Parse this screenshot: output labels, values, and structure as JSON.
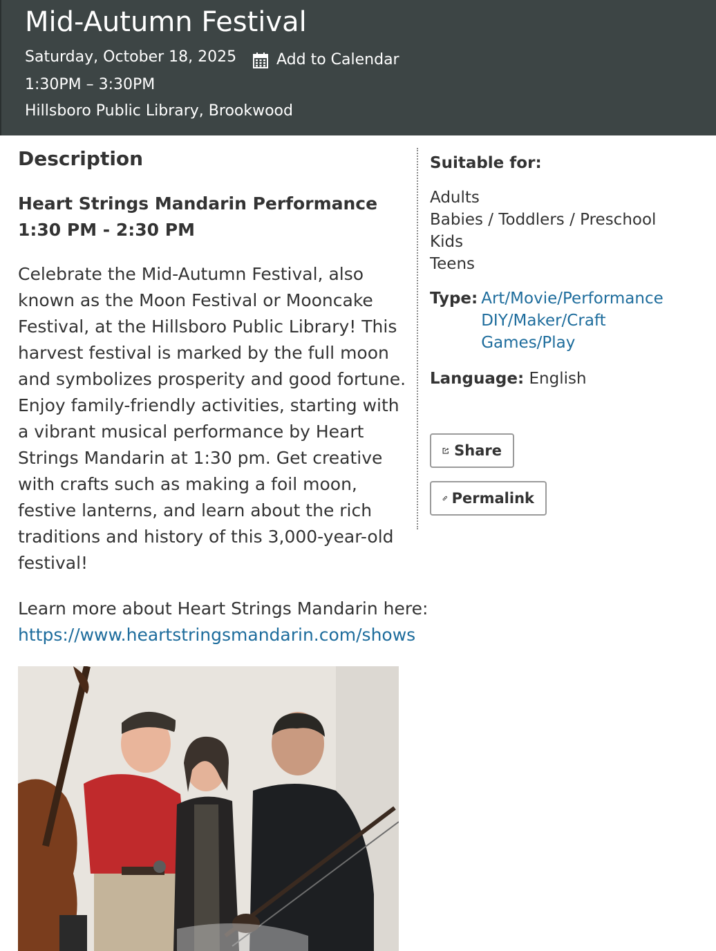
{
  "event": {
    "title": "Mid-Autumn Festival",
    "date": "Saturday, October 18, 2025",
    "add_to_calendar": "Add to Calendar",
    "time": "1:30PM – 3:30PM",
    "location": "Hillsboro Public Library, Brookwood"
  },
  "description": {
    "heading": "Description",
    "performance_name": "Heart Strings Mandarin Performance",
    "performance_time": "1:30 PM - 2:30 PM",
    "body": "Celebrate the Mid-Autumn Festival, also known as the Moon Festival or Mooncake Festival, at the Hillsboro Public Library! This harvest festival is marked by the full moon and symbolizes prosperity and good fortune. Enjoy family-friendly activities, starting with a vibrant musical performance by Heart Strings Mandarin at 1:30 pm. Get creative with crafts such as making a foil moon, festive lanterns, and learn about the rich traditions and history of this 3,000-year-old festival!",
    "learn_more_text": "Learn more about Heart Strings Mandarin here:",
    "learn_more_link": "https://www.heartstringsmandarin.com/shows"
  },
  "sidebar": {
    "suitable_heading": "Suitable for:",
    "audiences": [
      "Adults",
      "Babies / Toddlers / Preschool",
      "Kids",
      "Teens"
    ],
    "type_label": "Type:",
    "types": [
      "Art/Movie/Performance",
      "DIY/Maker/Craft",
      "Games/Play"
    ],
    "language_label": "Language:",
    "language_value": "English",
    "share_label": "Share",
    "permalink_label": "Permalink"
  },
  "colors": {
    "header_bg": "#3d4545",
    "link": "#1d6c9c",
    "text": "#333333"
  },
  "icons": {
    "calendar": "calendar-icon",
    "share": "share-icon",
    "link": "link-icon"
  }
}
